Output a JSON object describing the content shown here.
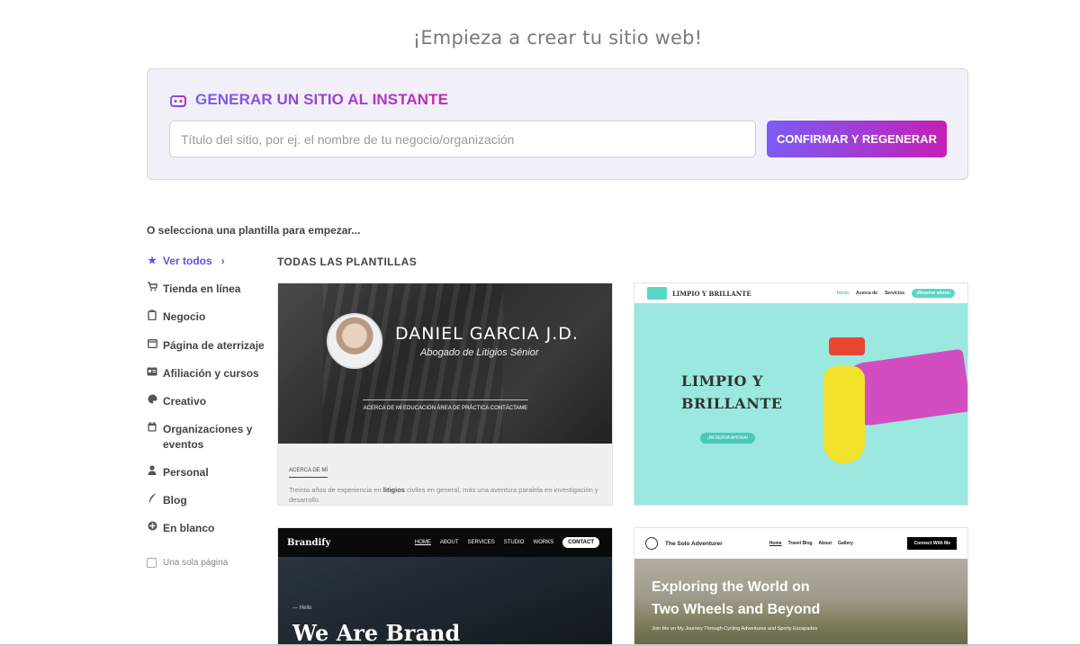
{
  "page": {
    "title": "¡Empieza a crear tu sitio web!"
  },
  "generator": {
    "title": "GENERAR UN SITIO AL INSTANTE",
    "icon": "robot-icon",
    "input_placeholder": "Título del sitio, por ej. el nombre de tu negocio/organización",
    "input_value": "",
    "button_label": "CONFIRMAR Y REGENERAR",
    "gradient_colors": [
      "#7b5cf5",
      "#c51fb5"
    ]
  },
  "section_label": "O selecciona una plantilla para empezar...",
  "sidebar": {
    "items": [
      {
        "label": "Ver todos",
        "icon": "star-icon",
        "glyph": "★",
        "active": true,
        "suffix": "›"
      },
      {
        "label": "Tienda en línea",
        "icon": "cart-icon",
        "glyph": "🛒"
      },
      {
        "label": "Negocio",
        "icon": "clipboard-icon",
        "glyph": "📋"
      },
      {
        "label": "Página de aterrizaje",
        "icon": "window-icon",
        "glyph": "▭"
      },
      {
        "label": "Afiliación y cursos",
        "icon": "id-card-icon",
        "glyph": "▤"
      },
      {
        "label": "Creativo",
        "icon": "palette-icon",
        "glyph": "◕"
      },
      {
        "label": "Organizaciones y eventos",
        "icon": "calendar-icon",
        "glyph": "▦"
      },
      {
        "label": "Personal",
        "icon": "person-icon",
        "glyph": "👤"
      },
      {
        "label": "Blog",
        "icon": "quill-icon",
        "glyph": "✒"
      },
      {
        "label": "En blanco",
        "icon": "plus-circle-icon",
        "glyph": "⊕"
      }
    ],
    "one_page_label": "Una sola página",
    "one_page_checked": false
  },
  "templates": {
    "heading": "TODAS LAS PLANTILLAS",
    "card1": {
      "name": "DANIEL GARCIA J.D.",
      "role": "Abogado de Litigios Sénior",
      "nav": [
        "ACERCA DE MÍ",
        "EDUCACIÓN",
        "ÁREA DE PRÁCTICA",
        "CONTÁCTAME"
      ],
      "section_heading": "ACERCA DE MÍ",
      "text_before": "Treinta años de experiencia en ",
      "text_bold": "litigios",
      "text_after": " civiles en general, más una aventura paralela en investigación y desarrollo."
    },
    "card2": {
      "brand": "LIMPIO Y BRILLANTE",
      "nav": [
        "Inicio",
        "Acerca de",
        "Servicios"
      ],
      "nav_button": "¡Reserve ahora!",
      "title_line1": "LIMPIO Y",
      "title_line2": "BRILLANTE",
      "cta": "¡RESERVA AHORA!",
      "accent": "#58d6c8"
    },
    "card3": {
      "brand": "Brandify",
      "nav": [
        "HOME",
        "ABOUT",
        "SERVICES",
        "STUDIO",
        "WORKS"
      ],
      "nav_button": "CONTACT",
      "hello": "— Hello",
      "headline": "We Are Brand"
    },
    "card4": {
      "brand": "The Solo Adventurer",
      "nav": [
        "Home",
        "Travel Blog",
        "About",
        "Gallery"
      ],
      "nav_button": "Connect With Me",
      "title_line1": "Exploring the World on",
      "title_line2": "Two Wheels and Beyond",
      "subtitle": "Join Me on My Journey Through Cycling Adventures and Sporty Escapades"
    }
  }
}
